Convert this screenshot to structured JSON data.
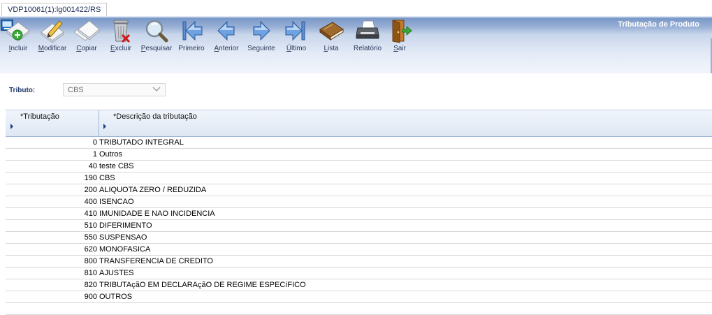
{
  "tab": {
    "label": "VDP10061(1):lg001422/RS"
  },
  "window": {
    "title": "Tributação de Produto"
  },
  "toolbar": {
    "buttons": [
      {
        "label": "Incluir",
        "icon": "add-icon"
      },
      {
        "label": "Modificar",
        "icon": "edit-icon"
      },
      {
        "label": "Copiar",
        "icon": "copy-icon"
      },
      {
        "label": "Excluir",
        "icon": "trash-icon"
      },
      {
        "label": "Pesquisar",
        "icon": "search-icon"
      },
      {
        "label": "Primeiro",
        "icon": "first-icon"
      },
      {
        "label": "Anterior",
        "icon": "previous-icon"
      },
      {
        "label": "Seguinte",
        "icon": "next-icon"
      },
      {
        "label": "Último",
        "icon": "last-icon"
      },
      {
        "label": "Lista",
        "icon": "book-icon"
      },
      {
        "label": "Relatório",
        "icon": "printer-icon"
      },
      {
        "label": "Sair",
        "icon": "exit-door-icon"
      }
    ]
  },
  "form": {
    "tributo_label": "Tributo:",
    "tributo_value": "CBS"
  },
  "grid": {
    "headers": [
      "*Tributação",
      "*Descrição da tributação"
    ],
    "rows": [
      {
        "code": "0",
        "desc": "TRIBUTADO INTEGRAL"
      },
      {
        "code": "1",
        "desc": "Outros"
      },
      {
        "code": "40",
        "desc": "teste CBS"
      },
      {
        "code": "190",
        "desc": "CBS"
      },
      {
        "code": "200",
        "desc": "ALIQUOTA ZERO / REDUZIDA"
      },
      {
        "code": "400",
        "desc": "ISENCAO"
      },
      {
        "code": "410",
        "desc": "IMUNIDADE E NAO INCIDENCIA"
      },
      {
        "code": "510",
        "desc": "DIFERIMENTO"
      },
      {
        "code": "550",
        "desc": "SUSPENSAO"
      },
      {
        "code": "620",
        "desc": "MONOFASICA"
      },
      {
        "code": "800",
        "desc": "TRANSFERENCIA DE CREDITO"
      },
      {
        "code": "810",
        "desc": "AJUSTES"
      },
      {
        "code": "820",
        "desc": "TRIBUTAçãO EM DECLARAçãO DE REGIME ESPECíFICO"
      },
      {
        "code": "900",
        "desc": "OUTROS"
      }
    ]
  }
}
